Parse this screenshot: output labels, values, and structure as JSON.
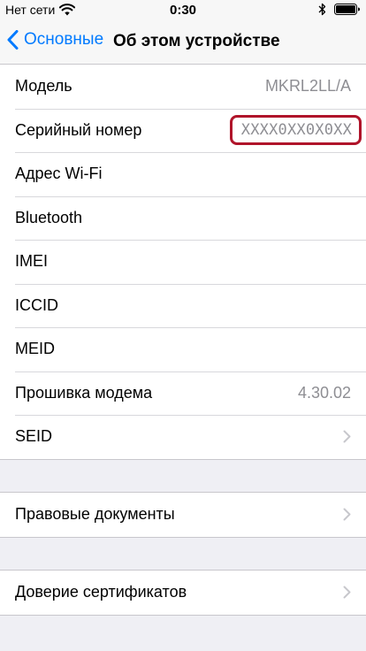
{
  "status_bar": {
    "carrier": "Нет сети",
    "time": "0:30"
  },
  "nav": {
    "back_label": "Основные",
    "title": "Об этом устройстве"
  },
  "rows": [
    {
      "label": "Модель",
      "value": "MKRL2LL/A"
    },
    {
      "label": "Серийный номер",
      "value": "XXXX0XX0X0XX"
    },
    {
      "label": "Адрес Wi-Fi",
      "value": ""
    },
    {
      "label": "Bluetooth",
      "value": ""
    },
    {
      "label": "IMEI",
      "value": ""
    },
    {
      "label": "ICCID",
      "value": ""
    },
    {
      "label": "MEID",
      "value": ""
    },
    {
      "label": "Прошивка модема",
      "value": "4.30.02"
    },
    {
      "label": "SEID",
      "value": ""
    }
  ],
  "legal": {
    "label": "Правовые документы"
  },
  "trust": {
    "label": "Доверие сертификатов"
  },
  "colors": {
    "accent": "#007aff",
    "highlight_border": "#b0142a",
    "background": "#efeff4",
    "secondary_text": "#8e8e93"
  },
  "icons": [
    "wifi-icon",
    "bluetooth-icon",
    "battery-icon",
    "chevron-left-icon",
    "chevron-right-icon"
  ]
}
